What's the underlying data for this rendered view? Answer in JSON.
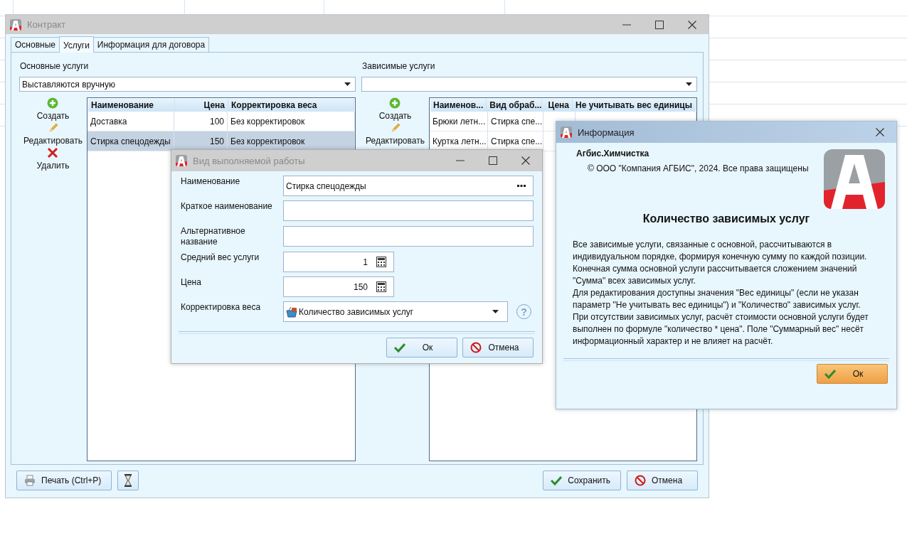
{
  "main_window": {
    "title": "Контракт",
    "tabs": [
      {
        "label": "Основные",
        "selected": false
      },
      {
        "label": "Услуги",
        "selected": true
      },
      {
        "label": "Информация для договора",
        "selected": false
      }
    ],
    "primary": {
      "label": "Основные услуги",
      "combo_value": "Выставляются вручную",
      "actions": [
        {
          "kind": "create",
          "label": "Создать"
        },
        {
          "kind": "edit",
          "label": "Редактировать"
        },
        {
          "kind": "delete",
          "label": "Удалить"
        }
      ],
      "table": {
        "columns": [
          "Наименование",
          "Цена",
          "Корректировка веса"
        ],
        "rows": [
          {
            "cells": [
              "Доставка",
              "100",
              "Без корректировок"
            ],
            "selected": false
          },
          {
            "cells": [
              "Стирка спецодежды",
              "150",
              "Без корректировок"
            ],
            "selected": true
          }
        ]
      }
    },
    "dependent": {
      "label": "Зависимые услуги",
      "actions": [
        {
          "kind": "create",
          "label": "Создать"
        },
        {
          "kind": "edit",
          "label": "Редактировать"
        }
      ],
      "table": {
        "columns": [
          "Наименов...",
          "Вид обраб...",
          "Цена",
          "Не учитывать вес единицы"
        ],
        "rows": [
          {
            "cells": [
              "Брюки летн...",
              "Стирка спе..."
            ]
          },
          {
            "cells": [
              "Куртка летн...",
              "Стирка спе..."
            ]
          }
        ]
      }
    },
    "footer_left": [
      {
        "kind": "print",
        "label": "Печать (Ctrl+P)"
      },
      {
        "kind": "hourglass"
      }
    ],
    "footer_right": [
      {
        "kind": "save",
        "label": "Сохранить"
      },
      {
        "kind": "cancel",
        "label": "Отмена"
      }
    ]
  },
  "work_dialog": {
    "title": "Вид выполняемой работы",
    "fields": [
      {
        "kind": "lookup",
        "label": "Наименование",
        "value": "Стирка спецодежды"
      },
      {
        "kind": "text",
        "label": "Краткое наименование"
      },
      {
        "kind": "text",
        "label": "Альтернативное название"
      },
      {
        "kind": "number",
        "label": "Средний вес услуги",
        "value": "1"
      },
      {
        "kind": "number",
        "label": "Цена",
        "value": "150"
      },
      {
        "kind": "combo",
        "label": "Корректировка веса",
        "value": "Количество зависимых услуг",
        "help": "?"
      }
    ],
    "buttons": [
      {
        "kind": "ok",
        "label": "Ок"
      },
      {
        "kind": "cancel",
        "label": "Отмена"
      }
    ]
  },
  "info_dialog": {
    "title": "Информация",
    "product": "Агбис.Химчистка",
    "copyright": "© ООО \"Компания АГБИС\", 2024. Все права защищены",
    "heading": "Количество зависимых услуг",
    "paragraphs": [
      "Все зависимые услуги, связанные с основной, рассчитываются в индивидуальном порядке, формируя конечную сумму по каждой позиции.",
      "Конечная сумма основной услуги рассчитывается сложением значений \"Сумма\" всех зависимых услуг.",
      "Для редактирования доступны значения \"Вес единицы\" (если не указан параметр \"Не учитывать вес единицы\") и \"Количество\" зависимых услуг.",
      "При отсутствии зависимых услуг, расчёт стоимости основной услуги будет выполнен по формуле \"количество * цена\". Поле \"Суммарный вес\" несёт информационный характер и не влияет на расчёт."
    ],
    "button": {
      "kind": "ok",
      "label": "Ок"
    }
  }
}
